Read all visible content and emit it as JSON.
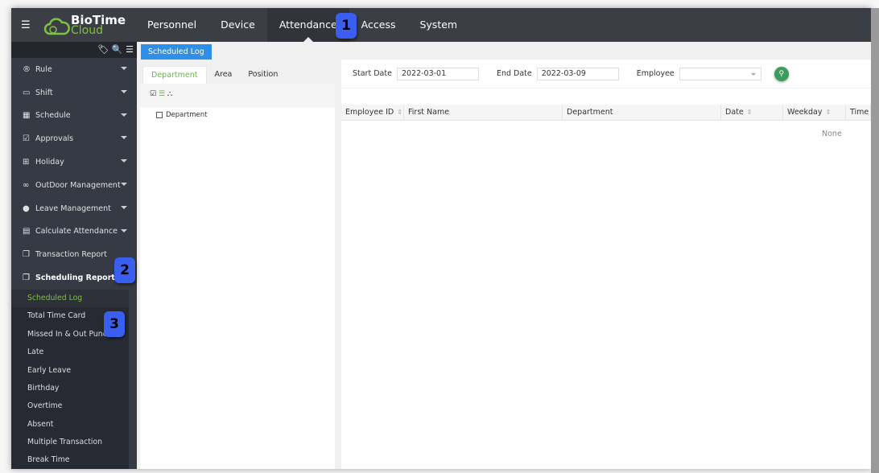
{
  "header": {
    "logo_line1": "BioTime",
    "logo_line2": "Cloud",
    "nav": [
      {
        "label": "Personnel"
      },
      {
        "label": "Device"
      },
      {
        "label": "Attendance",
        "active": true
      },
      {
        "label": "Access"
      },
      {
        "label": "System"
      }
    ]
  },
  "sidebar": {
    "items": [
      {
        "label": "Rule",
        "icon": "registered-icon"
      },
      {
        "label": "Shift",
        "icon": "calendar-icon"
      },
      {
        "label": "Schedule",
        "icon": "calendar-grid-icon"
      },
      {
        "label": "Approvals",
        "icon": "check-square-icon"
      },
      {
        "label": "Holiday",
        "icon": "calendar-plus-icon"
      },
      {
        "label": "OutDoor Management",
        "icon": "bicycle-icon"
      },
      {
        "label": "Leave Management",
        "icon": "user-circle-icon"
      },
      {
        "label": "Calculate Attendance",
        "icon": "calculator-icon"
      },
      {
        "label": "Transaction Report",
        "icon": "copy-icon"
      },
      {
        "label": "Scheduling Report",
        "icon": "copy-icon"
      }
    ],
    "subitems": [
      {
        "label": "Scheduled Log",
        "active": true
      },
      {
        "label": "Total Time Card"
      },
      {
        "label": "Missed In & Out Punch"
      },
      {
        "label": "Late"
      },
      {
        "label": "Early Leave"
      },
      {
        "label": "Birthday"
      },
      {
        "label": "Overtime"
      },
      {
        "label": "Absent"
      },
      {
        "label": "Multiple Transaction"
      },
      {
        "label": "Break Time"
      }
    ]
  },
  "tab": {
    "label": "Scheduled Log"
  },
  "left_panel": {
    "tabs": [
      "Department",
      "Area",
      "Position"
    ],
    "tree_root": "Department"
  },
  "filters": {
    "start_label": "Start Date",
    "start_value": "2022-03-01",
    "end_label": "End Date",
    "end_value": "2022-03-09",
    "employee_label": "Employee",
    "employee_value": ""
  },
  "table": {
    "columns": [
      "Employee ID",
      "First Name",
      "Department",
      "Date",
      "Weekday",
      "Time"
    ],
    "empty_text": "None"
  },
  "callouts": [
    "1",
    "2",
    "3"
  ],
  "colors": {
    "accent_green": "#7ec242",
    "tab_blue": "#2e8fe9",
    "callout_blue": "#3a5ff0",
    "search_green": "#3d9b5c"
  }
}
